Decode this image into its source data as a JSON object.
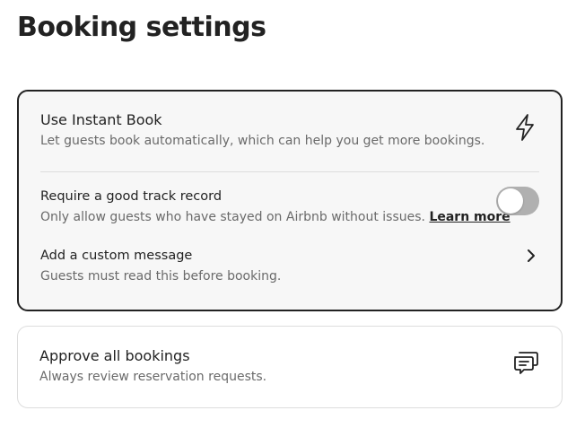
{
  "page_title": "Booking settings",
  "instant_book": {
    "title": "Use Instant Book",
    "subtitle": "Let guests book automatically, which can help you get more bookings.",
    "icon": "lightning-icon",
    "options": {
      "track_record": {
        "title": "Require a good track record",
        "subtitle": "Only allow guests who have stayed on Airbnb without issues.",
        "link_label": "Learn more",
        "enabled": false
      },
      "custom_message": {
        "title": "Add a custom message",
        "subtitle": "Guests must read this before booking.",
        "icon": "chevron-right-icon"
      }
    }
  },
  "approve_bookings": {
    "title": "Approve all bookings",
    "subtitle": "Always review reservation requests.",
    "icon": "chat-bubbles-icon"
  },
  "colors": {
    "text_primary": "#222222",
    "text_secondary": "#6a6a6a",
    "toggle_off": "#b0b0b0",
    "selected_card_bg": "#f7f7f7",
    "border": "#dddddd"
  }
}
